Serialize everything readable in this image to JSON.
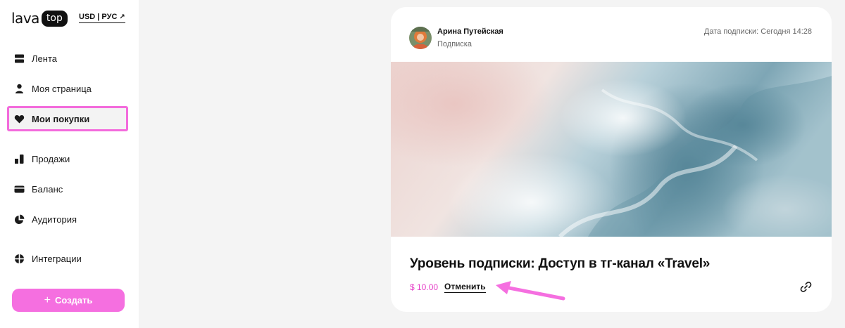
{
  "header": {
    "logo_word": "lava",
    "logo_badge": "top",
    "currency_label": "USD | РУС"
  },
  "sidebar": {
    "items": [
      {
        "id": "feed",
        "label": "Лента",
        "icon": "feed-icon"
      },
      {
        "id": "my-page",
        "label": "Моя страница",
        "icon": "user-icon"
      },
      {
        "id": "purchases",
        "label": "Мои покупки",
        "icon": "heart-icon",
        "active": true
      },
      {
        "id": "sales",
        "label": "Продажи",
        "icon": "bar-chart-icon"
      },
      {
        "id": "balance",
        "label": "Баланс",
        "icon": "card-icon"
      },
      {
        "id": "audience",
        "label": "Аудитория",
        "icon": "pie-chart-icon"
      },
      {
        "id": "integrations",
        "label": "Интеграции",
        "icon": "integrations-icon"
      }
    ],
    "create_label": "Создать"
  },
  "card": {
    "author_name": "Арина Путейская",
    "author_subtitle": "Подписка",
    "subscription_date": "Дата подписки: Сегодня 14:28",
    "title": "Уровень подписки: Доступ в тг-канал «Travel»",
    "price": "$ 10.00",
    "cancel_label": "Отменить"
  },
  "colors": {
    "accent": "#f56fe0",
    "active_border": "#f36bdc",
    "price": "#e640c8"
  }
}
